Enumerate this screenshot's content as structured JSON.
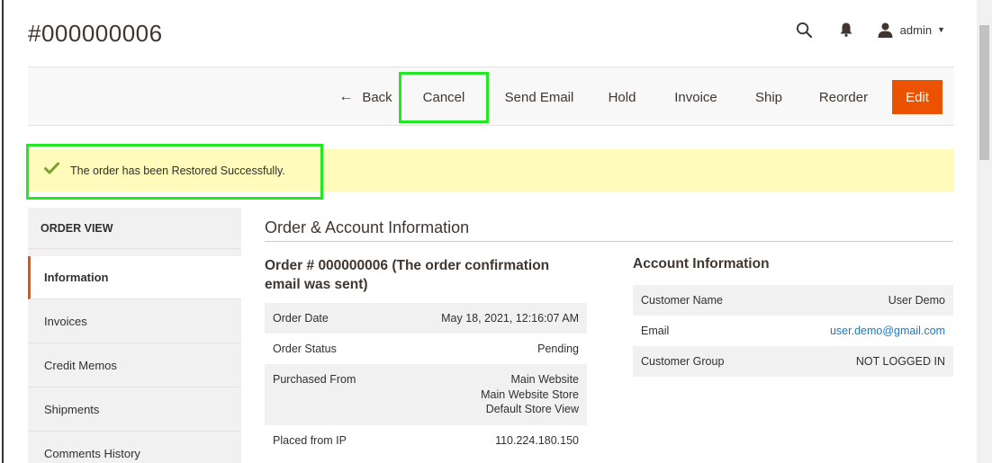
{
  "header": {
    "title": "#000000006",
    "user": "admin"
  },
  "actions": {
    "back": "Back",
    "cancel": "Cancel",
    "send_email": "Send Email",
    "hold": "Hold",
    "invoice": "Invoice",
    "ship": "Ship",
    "reorder": "Reorder",
    "edit": "Edit"
  },
  "message": "The order has been Restored Successfully.",
  "sidebar": {
    "heading": "ORDER VIEW",
    "items": [
      {
        "label": "Information"
      },
      {
        "label": "Invoices"
      },
      {
        "label": "Credit Memos"
      },
      {
        "label": "Shipments"
      },
      {
        "label": "Comments History"
      }
    ]
  },
  "section": {
    "title": "Order & Account Information"
  },
  "order": {
    "title": "Order # 000000006 (The order confirmation email was sent)",
    "rows": [
      {
        "label": "Order Date",
        "value": "May 18, 2021, 12:16:07 AM"
      },
      {
        "label": "Order Status",
        "value": "Pending"
      },
      {
        "label": "Purchased From",
        "value_lines": [
          "Main Website",
          "Main Website Store",
          "Default Store View"
        ]
      },
      {
        "label": "Placed from IP",
        "value": "110.224.180.150"
      }
    ]
  },
  "account": {
    "title": "Account Information",
    "rows": [
      {
        "label": "Customer Name",
        "value": "User Demo"
      },
      {
        "label": "Email",
        "value": "user.demo@gmail.com"
      },
      {
        "label": "Customer Group",
        "value": "NOT LOGGED IN"
      }
    ]
  },
  "colors": {
    "accent": "#eb5202",
    "highlight": "#24e724",
    "message_bg": "#fffbbb",
    "link": "#1979c3"
  }
}
